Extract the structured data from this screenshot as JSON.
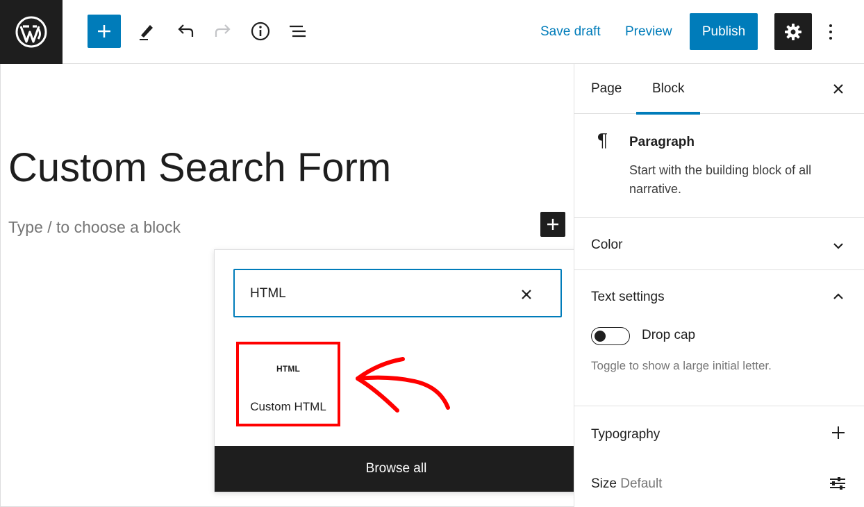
{
  "toolbar": {
    "save_draft": "Save draft",
    "preview": "Preview",
    "publish": "Publish"
  },
  "editor": {
    "post_title": "Custom Search Form",
    "block_placeholder": "Type / to choose a block"
  },
  "inserter": {
    "search_value": "HTML",
    "result_icon_text": "HTML",
    "result_label": "Custom HTML",
    "browse_all": "Browse all"
  },
  "sidebar": {
    "tabs": [
      {
        "label": "Page",
        "active": false
      },
      {
        "label": "Block",
        "active": true
      }
    ],
    "block_card": {
      "title": "Paragraph",
      "description": "Start with the building block of all narrative."
    },
    "color_panel": {
      "title": "Color",
      "expanded": false
    },
    "text_settings": {
      "title": "Text settings",
      "expanded": true,
      "drop_cap_label": "Drop cap",
      "drop_cap_help": "Toggle to show a large initial letter.",
      "drop_cap_enabled": false
    },
    "typography": {
      "title": "Typography",
      "size_label": "Size",
      "size_value": "Default"
    }
  },
  "colors": {
    "accent": "#007cba",
    "dark": "#1e1e1e",
    "highlight": "#ff0000"
  }
}
